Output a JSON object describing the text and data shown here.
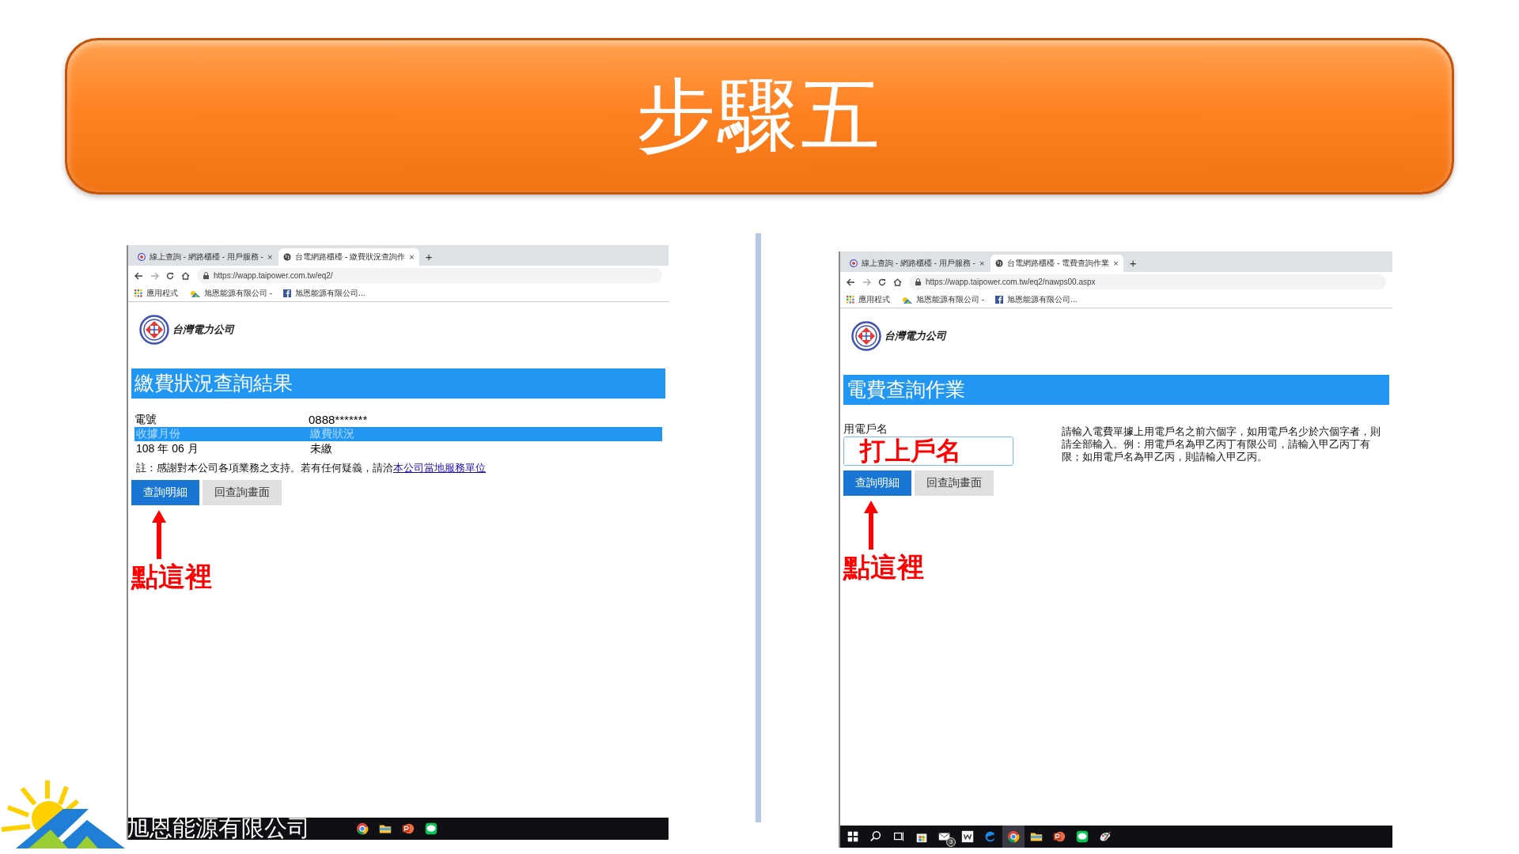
{
  "slide": {
    "title": "步驟五",
    "company": "旭恩能源有限公司"
  },
  "screenshots": [
    {
      "tabs": [
        {
          "title": "線上查詢 - 網路櫃檯 - 用戶服務 -",
          "close": "×",
          "selected": false
        },
        {
          "title": "台電網路櫃檯 - 繳費狀況查詢作",
          "close": "×",
          "selected": true
        }
      ],
      "new_tab": "+",
      "url": "https://wapp.taipower.com.tw/eq2/",
      "bookmarks": [
        {
          "kind": "apps",
          "label": "應用程式"
        },
        {
          "kind": "sun",
          "label": "旭恩能源有限公司 -"
        },
        {
          "kind": "facebook",
          "label": "旭恩能源有限公司..."
        }
      ],
      "logo_text": "台灣電力公司",
      "page": {
        "kind": "result",
        "heading": "繳費狀況查詢結果",
        "info": [
          {
            "label": "電號",
            "value": "0888*******"
          }
        ],
        "table": {
          "columns": [
            "收據月份",
            "繳費狀況"
          ],
          "rows": [
            [
              "108 年 06 月",
              "未繳"
            ]
          ]
        },
        "note": "註：感謝對本公司各項業務之支持。若有任何疑義，請洽",
        "note_link": "本公司當地服務單位",
        "buttons": [
          {
            "label": "查詢明細",
            "primary": true
          },
          {
            "label": "回查詢畫面",
            "primary": false
          }
        ],
        "annotation": "點這裡"
      },
      "taskbar": [
        {
          "kind": "chrome",
          "selected": false
        },
        {
          "kind": "folder",
          "selected": false
        },
        {
          "kind": "powerpoint",
          "selected": false
        },
        {
          "kind": "line",
          "selected": false
        }
      ]
    },
    {
      "tabs": [
        {
          "title": "線上查詢 - 網路櫃檯 - 用戶服務 -",
          "close": "×",
          "selected": false
        },
        {
          "title": "台電網路櫃檯 - 電費查詢作業",
          "close": "×",
          "selected": true
        }
      ],
      "new_tab": "+",
      "url": "https://wapp.taipower.com.tw/eq2/nawps00.aspx",
      "bookmarks": [
        {
          "kind": "apps",
          "label": "應用程式"
        },
        {
          "kind": "sun",
          "label": "旭恩能源有限公司 -"
        },
        {
          "kind": "facebook",
          "label": "旭恩能源有限公司..."
        }
      ],
      "logo_text": "台灣電力公司",
      "page": {
        "kind": "form",
        "heading": "電費查詢作業",
        "field_label": "用電戶名",
        "field_value": "打上戶名",
        "help": "請輸入電費單據上用電戶名之前六個字，如用電戶名少於六個字者，則請全部輸入。例：用電戶名為甲乙丙丁有限公司，請輸入甲乙丙丁有限；如用電戶名為甲乙丙，則請輸入甲乙丙。",
        "buttons": [
          {
            "label": "查詢明細",
            "primary": true
          },
          {
            "label": "回查詢畫面",
            "primary": false
          }
        ],
        "annotation": "點這裡"
      },
      "taskbar": [
        {
          "kind": "start",
          "selected": false
        },
        {
          "kind": "search",
          "selected": false
        },
        {
          "kind": "taskview",
          "selected": false
        },
        {
          "kind": "store",
          "selected": false
        },
        {
          "kind": "mail",
          "badge": "3",
          "selected": false
        },
        {
          "kind": "w",
          "selected": false
        },
        {
          "kind": "edge",
          "selected": false
        },
        {
          "kind": "chrome",
          "selected": true
        },
        {
          "kind": "folder",
          "selected": false
        },
        {
          "kind": "powerpoint",
          "selected": false
        },
        {
          "kind": "line",
          "selected": false
        },
        {
          "kind": "paint",
          "selected": false
        }
      ]
    }
  ]
}
